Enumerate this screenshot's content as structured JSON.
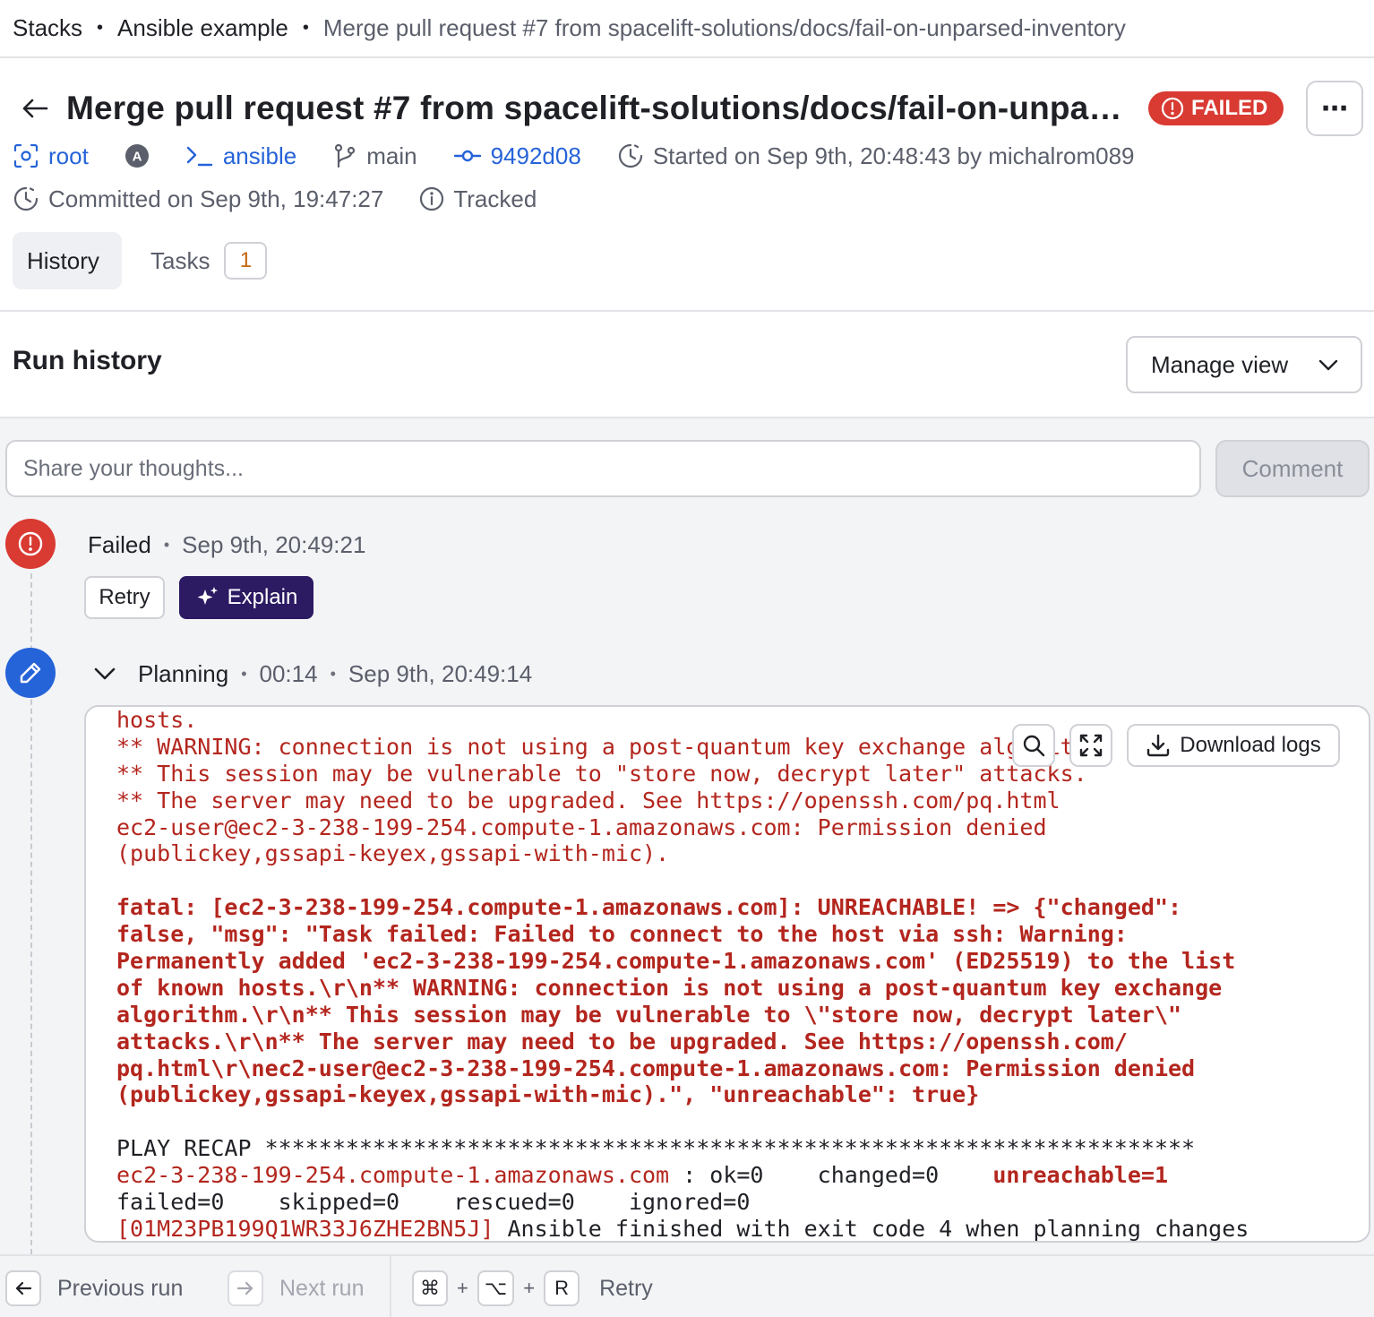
{
  "breadcrumb": {
    "items": [
      "Stacks",
      "Ansible example",
      "Merge pull request #7 from spacelift-solutions/docs/fail-on-unparsed-inventory"
    ]
  },
  "header": {
    "title": "Merge pull request #7 from spacelift-solutions/docs/fail-on-unparsed-inventory",
    "status": "FAILED",
    "more_label": "⋯",
    "meta": {
      "space": "root",
      "avatar_letter": "A",
      "stack": "ansible",
      "branch": "main",
      "commit": "9492d08",
      "started": "Started on Sep 9th, 20:48:43 by michalrom089",
      "committed": "Committed on Sep 9th, 19:47:27",
      "tracked": "Tracked"
    }
  },
  "tabs": {
    "history": "History",
    "tasks": "Tasks",
    "tasks_count": "1"
  },
  "run_history": {
    "title": "Run history",
    "manage_view": "Manage view"
  },
  "comment": {
    "placeholder": "Share your thoughts...",
    "button": "Comment"
  },
  "events": {
    "failed": {
      "name": "Failed",
      "time": "Sep 9th, 20:49:21",
      "retry": "Retry",
      "explain": "Explain"
    },
    "planning": {
      "name": "Planning",
      "duration": "00:14",
      "time": "Sep 9th, 20:49:14"
    }
  },
  "log": {
    "download_label": "Download logs",
    "lines": [
      {
        "style": "r",
        "text": "hosts."
      },
      {
        "style": "r",
        "text": "** WARNING: connection is not using a post-quantum key exchange algorithm."
      },
      {
        "style": "r",
        "text": "** This session may be vulnerable to \"store now, decrypt later\" attacks."
      },
      {
        "style": "r",
        "text": "** The server may need to be upgraded. See https://openssh.com/pq.html"
      },
      {
        "style": "r",
        "text": "ec2-user@ec2-3-238-199-254.compute-1.amazonaws.com: Permission denied"
      },
      {
        "style": "r",
        "text": "(publickey,gssapi-keyex,gssapi-with-mic)."
      },
      {
        "style": "r",
        "text": ""
      },
      {
        "style": "rb",
        "text": "fatal: [ec2-3-238-199-254.compute-1.amazonaws.com]: UNREACHABLE! => {\"changed\":"
      },
      {
        "style": "rb",
        "text": "false, \"msg\": \"Task failed: Failed to connect to the host via ssh: Warning:"
      },
      {
        "style": "rb",
        "text": "Permanently added 'ec2-3-238-199-254.compute-1.amazonaws.com' (ED25519) to the list"
      },
      {
        "style": "rb",
        "text": "of known hosts.\\r\\n** WARNING: connection is not using a post-quantum key exchange"
      },
      {
        "style": "rb",
        "text": "algorithm.\\r\\n** This session may be vulnerable to \\\"store now, decrypt later\\\""
      },
      {
        "style": "rb",
        "text": "attacks.\\r\\n** The server may need to be upgraded. See https://openssh.com/"
      },
      {
        "style": "rb",
        "text": "pq.html\\r\\nec2-user@ec2-3-238-199-254.compute-1.amazonaws.com: Permission denied"
      },
      {
        "style": "rb",
        "text": "(publickey,gssapi-keyex,gssapi-with-mic).\", \"unreachable\": true}"
      },
      {
        "style": "r",
        "text": ""
      },
      {
        "style": "k",
        "text": "PLAY RECAP *********************************************************************"
      },
      {
        "style": "recap",
        "host": "ec2-3-238-199-254.compute-1.amazonaws.com",
        "mid": " : ok=0    changed=0    ",
        "unreachable": "unreachable=1"
      },
      {
        "style": "k",
        "text": "failed=0    skipped=0    rescued=0    ignored=0"
      },
      {
        "style": "final",
        "id": "[01M23PB199Q1WR33J6ZHE2BN5J]",
        "msg": " Ansible finished with exit code 4 when planning changes"
      }
    ]
  },
  "bottom_bar": {
    "previous": "Previous run",
    "next": "Next run",
    "key_cmd": "⌘",
    "key_opt": "⌥",
    "key_r": "R",
    "plus": "+",
    "retry": "Retry"
  }
}
